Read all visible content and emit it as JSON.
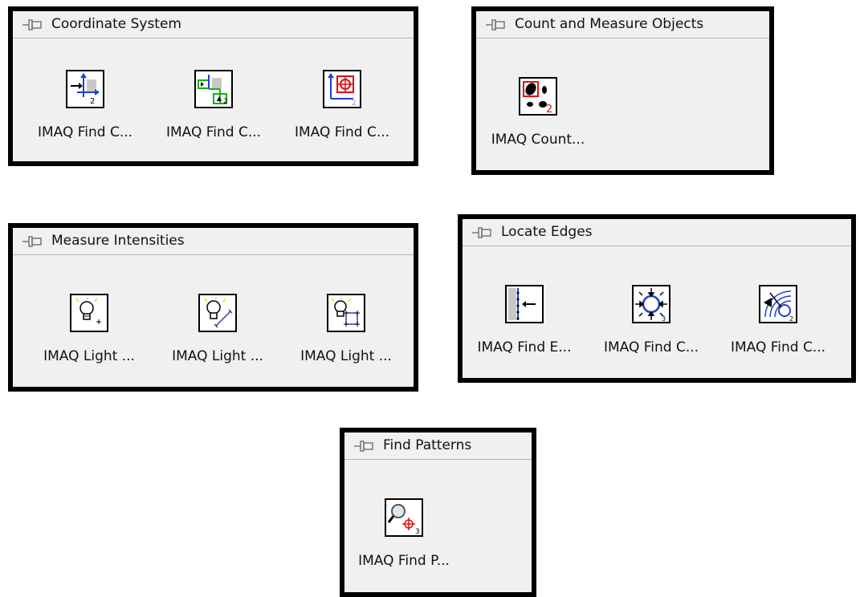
{
  "palettes": [
    {
      "title": "Coordinate System",
      "items": [
        {
          "label": "IMAQ Find C...",
          "icon": "coordinate-system-from-edges-icon"
        },
        {
          "label": "IMAQ Find C...",
          "icon": "coordinate-system-from-two-edges-icon"
        },
        {
          "label": "IMAQ Find C...",
          "icon": "coordinate-system-from-pattern-icon"
        }
      ]
    },
    {
      "title": "Count and Measure Objects",
      "items": [
        {
          "label": "IMAQ Count...",
          "icon": "count-objects-icon"
        }
      ]
    },
    {
      "title": "Measure Intensities",
      "items": [
        {
          "label": "IMAQ Light ...",
          "icon": "light-meter-point-icon"
        },
        {
          "label": "IMAQ Light ...",
          "icon": "light-meter-line-icon"
        },
        {
          "label": "IMAQ Light ...",
          "icon": "light-meter-rectangle-icon"
        }
      ]
    },
    {
      "title": "Locate Edges",
      "items": [
        {
          "label": "IMAQ Find E...",
          "icon": "find-edge-icon"
        },
        {
          "label": "IMAQ Find C...",
          "icon": "find-circular-edge-icon"
        },
        {
          "label": "IMAQ Find C...",
          "icon": "find-concentric-edge-icon"
        }
      ]
    },
    {
      "title": "Find Patterns",
      "items": [
        {
          "label": "IMAQ Find P...",
          "icon": "find-pattern-icon"
        }
      ]
    }
  ],
  "colors": {
    "accent_blue": "#1f3fd6",
    "accent_red": "#e01010",
    "accent_green": "#10b010",
    "bulb_yellow": "#f2d430"
  }
}
